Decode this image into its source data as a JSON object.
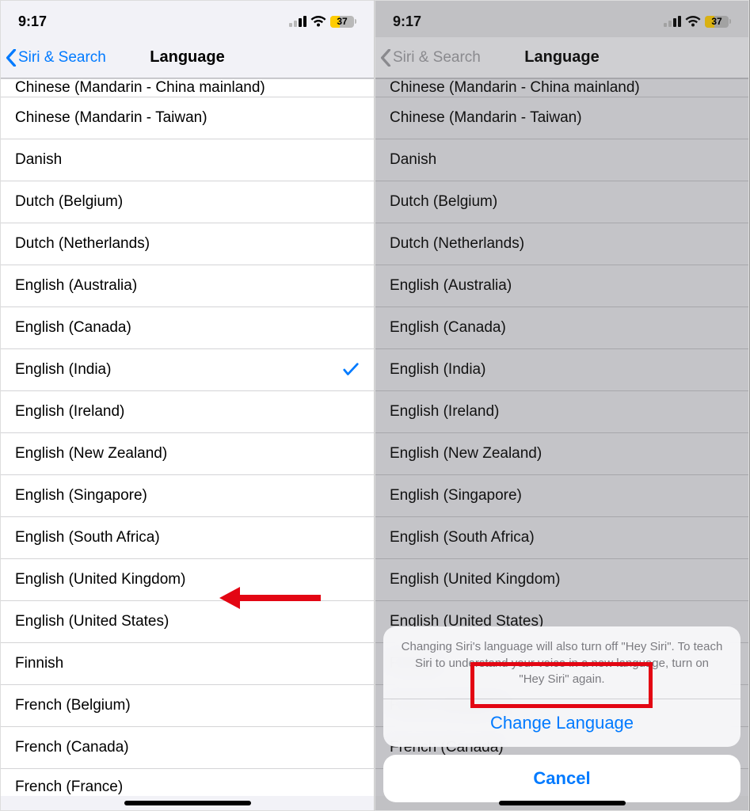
{
  "statusbar": {
    "time": "9:17",
    "battery": "37"
  },
  "nav": {
    "back": "Siri & Search",
    "title": "Language"
  },
  "left": {
    "clipped_top": "Chinese (Mandarin - China mainland)",
    "languages": [
      {
        "label": "Chinese (Mandarin - Taiwan)",
        "selected": false
      },
      {
        "label": "Danish",
        "selected": false
      },
      {
        "label": "Dutch (Belgium)",
        "selected": false
      },
      {
        "label": "Dutch (Netherlands)",
        "selected": false
      },
      {
        "label": "English (Australia)",
        "selected": false
      },
      {
        "label": "English (Canada)",
        "selected": false
      },
      {
        "label": "English (India)",
        "selected": true
      },
      {
        "label": "English (Ireland)",
        "selected": false
      },
      {
        "label": "English (New Zealand)",
        "selected": false
      },
      {
        "label": "English (Singapore)",
        "selected": false
      },
      {
        "label": "English (South Africa)",
        "selected": false
      },
      {
        "label": "English (United Kingdom)",
        "selected": false
      },
      {
        "label": "English (United States)",
        "selected": false
      },
      {
        "label": "Finnish",
        "selected": false
      },
      {
        "label": "French (Belgium)",
        "selected": false
      },
      {
        "label": "French (Canada)",
        "selected": false
      },
      {
        "label": "French (France)",
        "selected": false
      }
    ]
  },
  "right": {
    "clipped_top": "Chinese (Mandarin - China mainland)",
    "languages": [
      {
        "label": "Chinese (Mandarin - Taiwan)"
      },
      {
        "label": "Danish"
      },
      {
        "label": "Dutch (Belgium)"
      },
      {
        "label": "Dutch (Netherlands)"
      },
      {
        "label": "English (Australia)"
      },
      {
        "label": "English (Canada)"
      },
      {
        "label": "English (India)"
      },
      {
        "label": "English (Ireland)"
      },
      {
        "label": "English (New Zealand)"
      },
      {
        "label": "English (Singapore)"
      },
      {
        "label": "English (South Africa)"
      },
      {
        "label": "English (United Kingdom)"
      },
      {
        "label": "English (United States)"
      },
      {
        "label": "Finnish"
      },
      {
        "label": "French (Belgium)"
      },
      {
        "label": "French (Canada)"
      },
      {
        "label": "French (France)"
      }
    ]
  },
  "sheet": {
    "message": "Changing Siri's language will also turn off \"Hey Siri\". To teach Siri to understand your voice in a new language, turn on \"Hey Siri\" again.",
    "action": "Change Language",
    "cancel": "Cancel"
  }
}
